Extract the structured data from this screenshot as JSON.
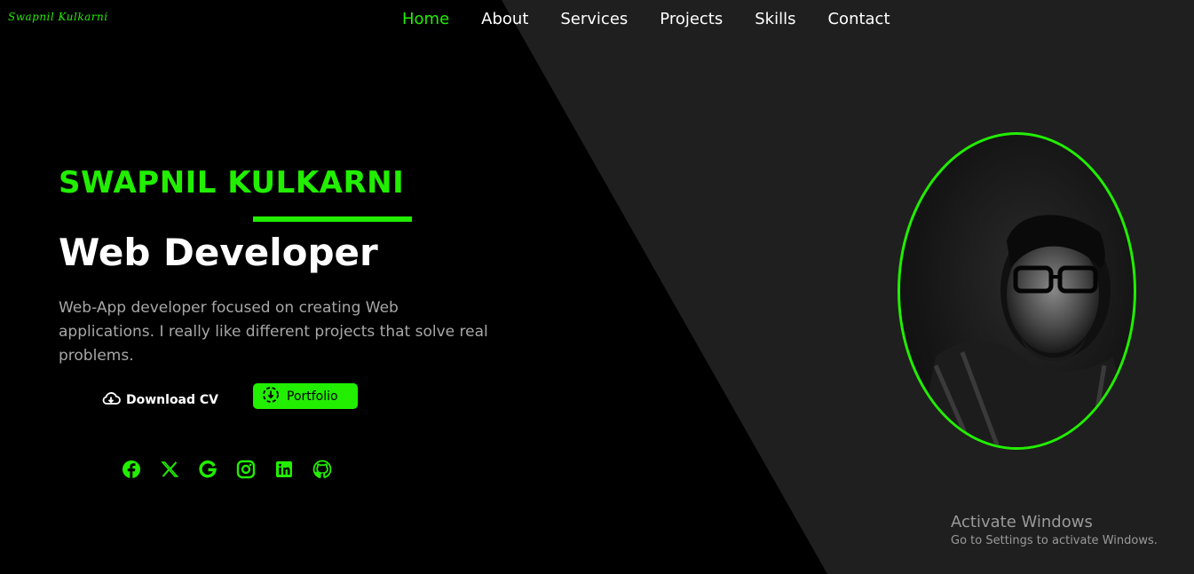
{
  "logo": {
    "text": "Swapnil Kulkarni"
  },
  "nav": {
    "items": [
      {
        "label": "Home",
        "active": true
      },
      {
        "label": "About"
      },
      {
        "label": "Services"
      },
      {
        "label": "Projects"
      },
      {
        "label": "Skills"
      },
      {
        "label": "Contact"
      }
    ]
  },
  "hero": {
    "name": "SWAPNIL KULKARNI",
    "role": "Web Developer",
    "description": "Web-App developer focused on creating Web applications. I really like different projects that solve real problems.",
    "download_label": "Download CV",
    "portfolio_label": "Portfolio"
  },
  "socials": [
    "facebook-icon",
    "x-icon",
    "google-icon",
    "instagram-icon",
    "linkedin-icon",
    "github-icon"
  ],
  "watermark": {
    "title": "Activate Windows",
    "subtitle": "Go to Settings to activate Windows."
  },
  "colors": {
    "accent": "#22ee00",
    "background_dark": "#000000",
    "background_panel": "#1f1f1f"
  }
}
